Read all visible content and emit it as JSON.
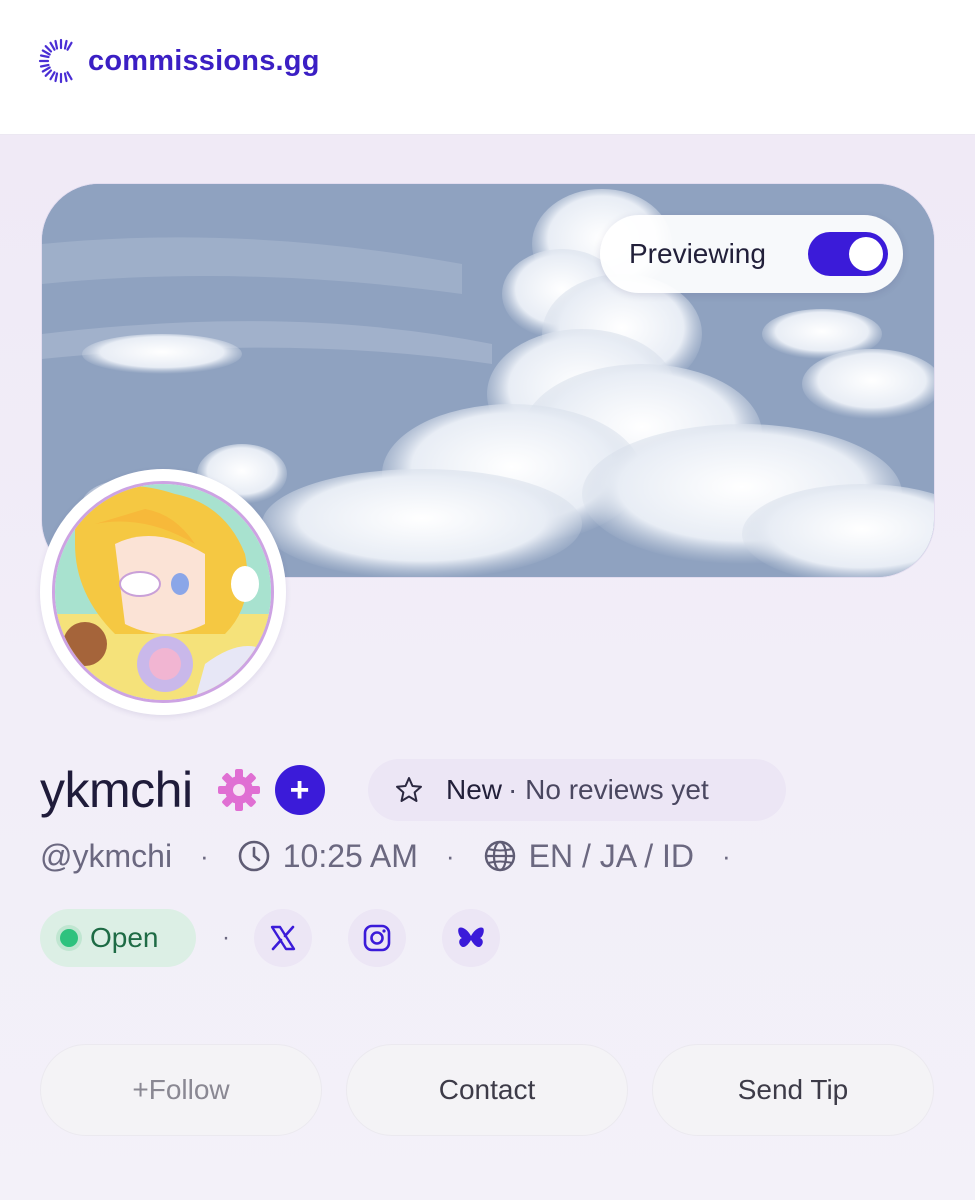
{
  "brand": {
    "name": "commissions.gg",
    "color": "#3b1fc4"
  },
  "banner": {
    "preview_label": "Previewing",
    "preview_enabled": true,
    "accent": "#3b1bd9"
  },
  "profile": {
    "display_name": "ykmchi",
    "handle": "@ykmchi",
    "time": "10:25 AM",
    "languages": "EN / JA / ID",
    "badges": [
      "gear-icon",
      "plus-icon"
    ],
    "rating": {
      "label": "New",
      "reviews": "· No reviews yet"
    },
    "status": {
      "label": "Open",
      "color": "#2ec27e"
    },
    "socials": [
      "x-icon",
      "instagram-icon",
      "bluesky-icon"
    ],
    "separator": "·"
  },
  "actions": {
    "follow": "+Follow",
    "contact": "Contact",
    "tip": "Send Tip"
  }
}
